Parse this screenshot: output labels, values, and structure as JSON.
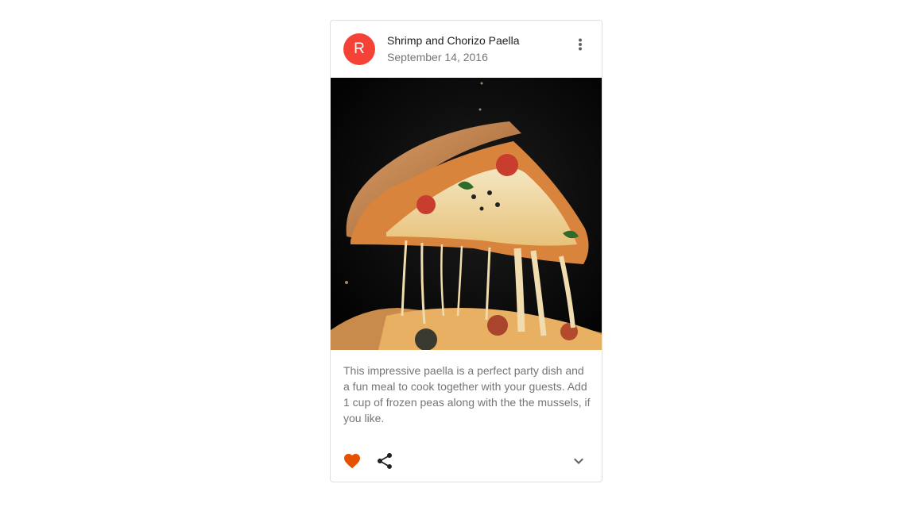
{
  "card": {
    "avatar_letter": "R",
    "title": "Shrimp and Chorizo Paella",
    "subheader": "September 14, 2016",
    "description": "This impressive paella is a perfect party dish and a fun meal to cook together with your guests. Add 1 cup of frozen peas along with the the mussels, if you like.",
    "media_alt": "pizza-slice-photo"
  },
  "icons": {
    "more": "more-vert-icon",
    "favorite": "favorite-icon",
    "share": "share-icon",
    "expand": "expand-more-icon"
  },
  "colors": {
    "avatar_bg": "#f44336",
    "favorite": "#e65100",
    "secondary_text": "#757575",
    "primary_text": "#212121"
  }
}
